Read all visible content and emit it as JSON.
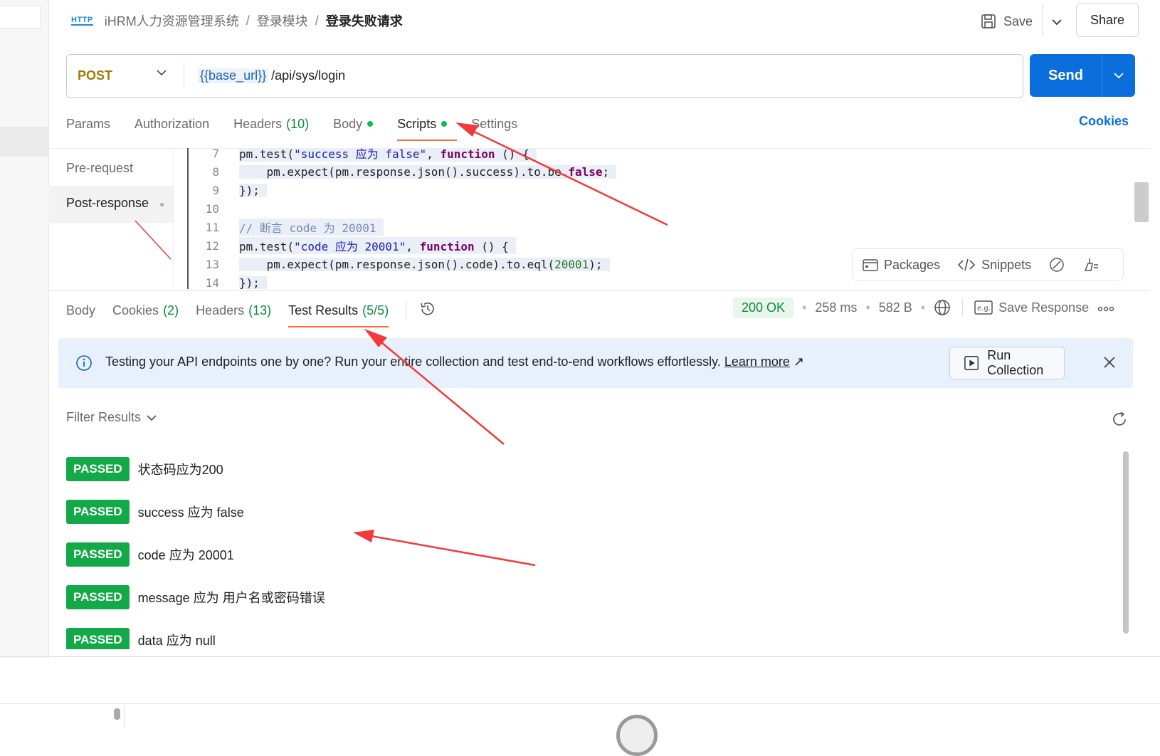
{
  "breadcrumb": {
    "icon": "HTTP",
    "items": [
      "iHRM人力资源管理系统",
      "登录模块"
    ],
    "separator": "/",
    "current": "登录失败请求"
  },
  "header": {
    "save_label": "Save",
    "share_label": "Share"
  },
  "request": {
    "method": "POST",
    "url_var": "{{base_url}}",
    "url_path": "/api/sys/login",
    "send_label": "Send"
  },
  "request_tabs": [
    {
      "label": "Params"
    },
    {
      "label": "Authorization"
    },
    {
      "label": "Headers",
      "count": "(10)"
    },
    {
      "label": "Body"
    },
    {
      "label": "Scripts"
    },
    {
      "label": "Settings"
    }
  ],
  "cookies_label": "Cookies",
  "scripts_nav": {
    "pre": "Pre-request",
    "post": "Post-response"
  },
  "code": [
    {
      "ln": "7",
      "text": "pm.test(\"success 应为 false\", function () {"
    },
    {
      "ln": "8",
      "text": "    pm.expect(pm.response.json().success).to.be.false;"
    },
    {
      "ln": "9",
      "text": "});"
    },
    {
      "ln": "10",
      "text": ""
    },
    {
      "ln": "11",
      "text": "// 断言 code 为 20001"
    },
    {
      "ln": "12",
      "text": "pm.test(\"code 应为 20001\", function () {"
    },
    {
      "ln": "13",
      "text": "    pm.expect(pm.response.json().code).to.eql(20001);"
    },
    {
      "ln": "14",
      "text": "});"
    }
  ],
  "tools": {
    "packages": "Packages",
    "snippets": "Snippets"
  },
  "response_tabs": [
    {
      "label": "Body"
    },
    {
      "label": "Cookies",
      "count": "(2)"
    },
    {
      "label": "Headers",
      "count": "(13)"
    },
    {
      "label": "Test Results",
      "count": "(5/5)"
    }
  ],
  "status": {
    "code": "200 OK",
    "time": "258 ms",
    "size": "582 B",
    "save_response": "Save Response",
    "separator": "•"
  },
  "banner": {
    "text": "Testing your API endpoints one by one? Run your entire collection and test end-to-end workflows effortlessly.",
    "link": "Learn more",
    "link_icon": "↗",
    "button": "Run Collection"
  },
  "filter_label": "Filter Results",
  "results": [
    {
      "status": "PASSED",
      "name": "状态码应为200"
    },
    {
      "status": "PASSED",
      "name": "success 应为 false"
    },
    {
      "status": "PASSED",
      "name": "code 应为 20001"
    },
    {
      "status": "PASSED",
      "name": "message 应为 用户名或密码错误"
    },
    {
      "status": "PASSED",
      "name": "data 应为 null"
    }
  ],
  "colors": {
    "accent": "#ff6c37",
    "send": "#0a6fdc",
    "passed": "#13a948",
    "annotation_arrow": "#f23a3a"
  }
}
